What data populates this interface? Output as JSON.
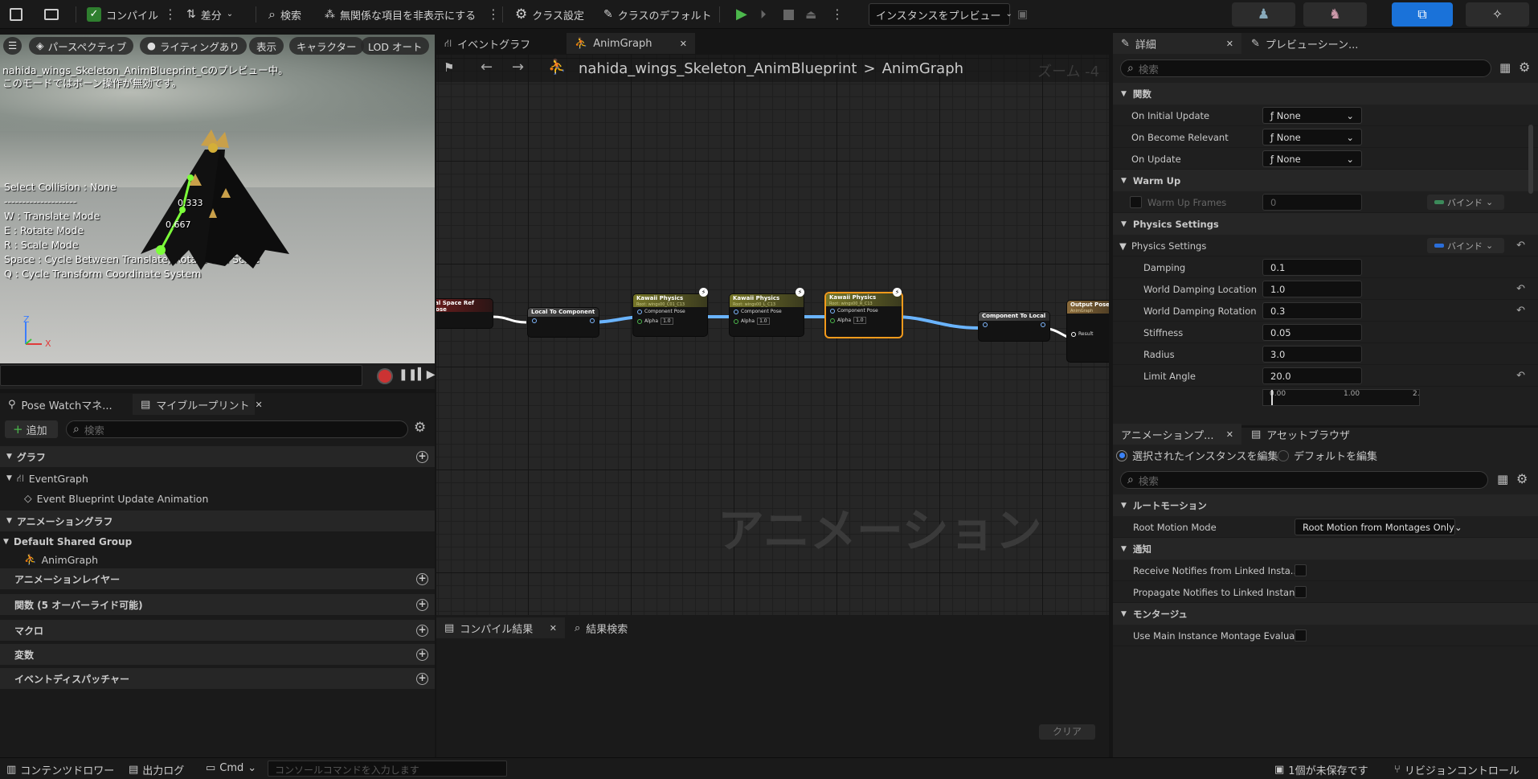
{
  "toolbar": {
    "compile": "コンパイル",
    "diff": "差分",
    "search": "検索",
    "hide_unrelated": "無関係な項目を非表示にする",
    "class_settings": "クラス設定",
    "class_defaults": "クラスのデフォルト",
    "preview_instance": "インスタンスをプレビュー"
  },
  "viewport": {
    "buttons": [
      "パースペクティブ",
      "ライティングあり",
      "表示",
      "キャラクター",
      "LOD オート"
    ],
    "preview_msg1": "nahida_wings_Skeleton_AnimBlueprint_Cのプレビュー中。",
    "preview_msg2": "このモードではボーン操作が無効です。",
    "info_lines": [
      "Select Collision : None",
      "--------------------",
      "W : Translate Mode",
      "E : Rotate Mode",
      "R : Scale Mode",
      "Space : Cycle Between Translate, Rotate and Scale",
      "Q : Cycle Transform Coordinate System"
    ],
    "label_a": "0.333",
    "label_b": "0.667",
    "axis_z": "Z",
    "axis_x": "X"
  },
  "left_panel": {
    "tab_pose_watch": "Pose Watchマネ...",
    "tab_my_blueprint": "マイブループリント",
    "add": "追加",
    "search_placeholder": "検索",
    "graph_header": "グラフ",
    "event_graph": "EventGraph",
    "event_update": "Event Blueprint Update Animation",
    "anim_graph_header": "アニメーショングラフ",
    "default_group": "Default Shared Group",
    "anim_graph": "AnimGraph",
    "anim_layers": "アニメーションレイヤー",
    "functions": "関数 (5 オーバーライド可能)",
    "macros": "マクロ",
    "variables": "変数",
    "dispatchers": "イベントディスパッチャー"
  },
  "graph": {
    "tab_event_graph": "イベントグラフ",
    "tab_anim_graph": "AnimGraph",
    "breadcrumb_bp": "nahida_wings_Skeleton_AnimBlueprint",
    "breadcrumb_sep": ">",
    "breadcrumb_graph": "AnimGraph",
    "zoom": "ズーム -4",
    "watermark": "アニメーション",
    "nodes": {
      "ref_pose": "cal Space Ref Pose",
      "local_to_comp": "Local To Component",
      "kawaii1_title": "Kawaii Physics",
      "kawaii1_sub": "Root: wings00_C01_C13",
      "kawaii2_title": "Kawaii Physics",
      "kawaii2_sub": "Root: wings00_L_C13",
      "kawaii3_title": "Kawaii Physics",
      "kawaii3_sub": "Root: wings00_R_C13",
      "component_pose": "Component Pose",
      "alpha": "Alpha",
      "alpha_value": "1.0",
      "comp_to_local": "Component To Local",
      "output_pose": "Output Pose",
      "output_sub": "AnimGraph",
      "result": "Result"
    },
    "compile_results_tab": "コンパイル結果",
    "find_results_tab": "結果検索",
    "clear": "クリア"
  },
  "details": {
    "tab_details": "詳細",
    "tab_preview_scene": "プレビューシーン...",
    "search_placeholder": "検索",
    "functions_header": "関数",
    "on_initial_update": "On Initial Update",
    "on_become_relevant": "On Become Relevant",
    "on_update": "On Update",
    "none": "None",
    "warm_up_header": "Warm Up",
    "warm_up_frames": "Warm Up Frames",
    "warm_up_value": "0",
    "bind": "バインド",
    "physics_settings_header": "Physics Settings",
    "physics_settings": "Physics Settings",
    "damping": "Damping",
    "damping_value": "0.1",
    "world_damping_location": "World Damping Location",
    "world_damping_location_value": "1.0",
    "world_damping_rotation": "World Damping Rotation",
    "world_damping_rotation_value": "0.3",
    "stiffness": "Stiffness",
    "stiffness_value": "0.05",
    "radius": "Radius",
    "radius_value": "3.0",
    "limit_angle": "Limit Angle",
    "limit_angle_value": "20.0",
    "curve_tick_0": "0.00",
    "curve_tick_1": "1.00",
    "curve_tick_2": "2."
  },
  "anim_preview": {
    "tab_anim": "アニメーションプ...",
    "tab_asset": "アセットブラウザ",
    "radio_selected": "選択されたインスタンスを編集",
    "radio_default": "デフォルトを編集",
    "search_placeholder": "検索",
    "root_motion_header": "ルートモーション",
    "root_motion_mode": "Root Motion Mode",
    "root_motion_value": "Root Motion from Montages Only",
    "notify_header": "通知",
    "receive_notifies": "Receive Notifies from Linked Insta...",
    "propagate_notifies": "Propagate Notifies to Linked Instan...",
    "montage_header": "モンタージュ",
    "use_main_montage": "Use Main Instance Montage Evalua..."
  },
  "status_bar": {
    "content_drawer": "コンテンツドロワー",
    "output_log": "出力ログ",
    "cmd": "Cmd",
    "console_placeholder": "コンソールコマンドを入力します",
    "unsaved": "1個が未保存です",
    "revision_control": "リビジョンコントロール"
  },
  "colors": {
    "accent": "#1a72d9",
    "selected_node": "#f39a1c",
    "wire": "#6ab4ff",
    "play": "#4cb84c"
  }
}
